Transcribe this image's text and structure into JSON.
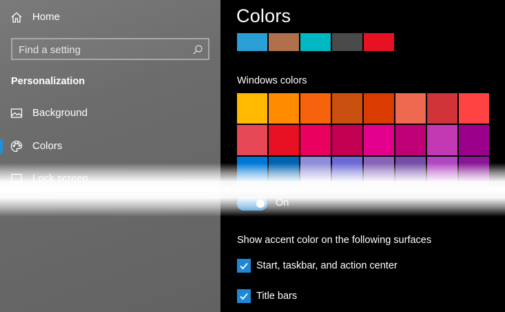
{
  "sidebar": {
    "home_label": "Home",
    "search_placeholder": "Find a setting",
    "section_title": "Personalization",
    "items": [
      {
        "label": "Background",
        "icon": "image-icon",
        "selected": false
      },
      {
        "label": "Colors",
        "icon": "palette-icon",
        "selected": true
      },
      {
        "label": "Lock screen",
        "icon": "lock-screen-icon",
        "selected": false
      }
    ]
  },
  "main": {
    "title": "Colors",
    "recent_colors": [
      "#2a9fd6",
      "#b0704b",
      "#00b7c3",
      "#4a4a4a",
      "#e81123"
    ],
    "windows_colors_label": "Windows colors",
    "windows_colors": [
      "#ffb900",
      "#ff8c00",
      "#f7630c",
      "#ca5010",
      "#da3b01",
      "#ef6950",
      "#d13438",
      "#ff4343",
      "#e74856",
      "#e81123",
      "#ea005e",
      "#c30052",
      "#e3008c",
      "#bf0077",
      "#c239b3",
      "#9a0089",
      "#0078d7",
      "#0063b1",
      "#8e8cd8",
      "#6b69d6",
      "#8764b8",
      "#744da9",
      "#b146c2",
      "#881798"
    ],
    "toggle_state": "On",
    "accent_surfaces_label": "Show accent color on the following surfaces",
    "checkboxes": [
      {
        "label": "Start, taskbar, and action center",
        "checked": true
      },
      {
        "label": "Title bars",
        "checked": true
      }
    ]
  },
  "colors": {
    "accent": "#1e88d6",
    "main_bg": "#000000",
    "sidebar_bg": "#6e6e6e"
  }
}
